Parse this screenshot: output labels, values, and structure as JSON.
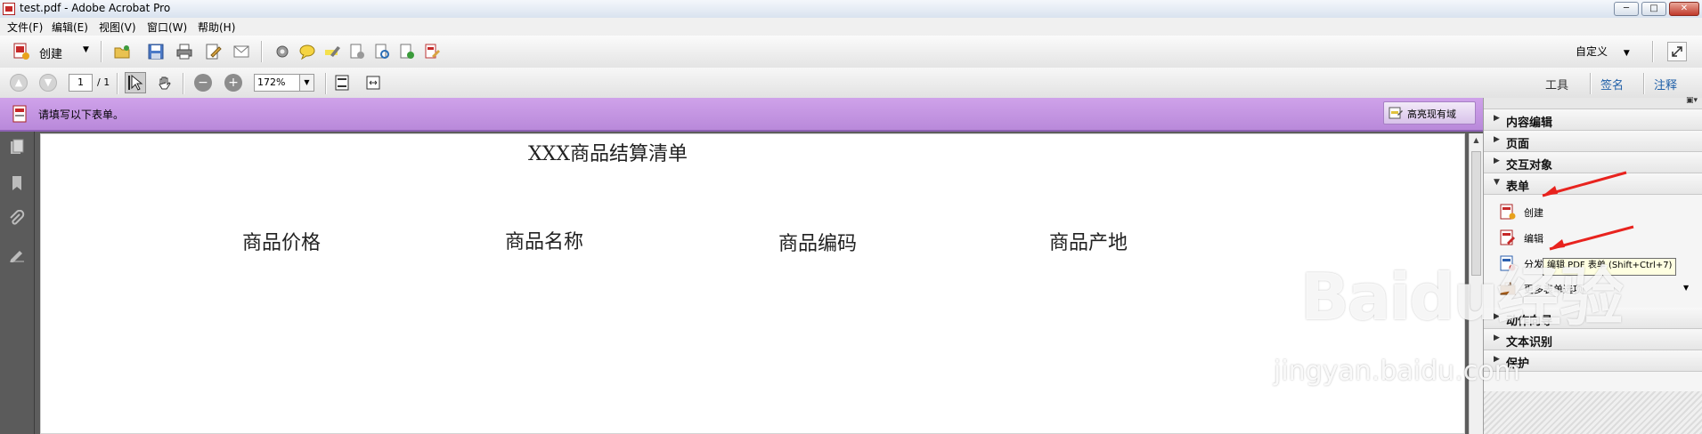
{
  "window": {
    "title": "test.pdf - Adobe Acrobat Pro",
    "min": "─",
    "max": "□",
    "close": "✕"
  },
  "menu": [
    {
      "label": "文件(F)"
    },
    {
      "label": "编辑(E)"
    },
    {
      "label": "视图(V)"
    },
    {
      "label": "窗口(W)"
    },
    {
      "label": "帮助(H)"
    }
  ],
  "toolbar": {
    "create_label": "创建",
    "customize_label": "自定义"
  },
  "nav": {
    "page_current": "1",
    "page_total": "/ 1",
    "zoom": "172%"
  },
  "panels": {
    "tools": "工具",
    "sign": "签名",
    "comment": "注释"
  },
  "formbar": {
    "message": "请填写以下表单。",
    "highlight_label": "高亮现有域"
  },
  "document": {
    "title": "XXX商品结算清单",
    "columns": [
      "商品价格",
      "商品名称",
      "商品编码",
      "商品产地"
    ]
  },
  "right_panel": {
    "sections_top": [
      "内容编辑",
      "页面",
      "交互对象"
    ],
    "forms_section": "表单",
    "form_items": [
      "创建",
      "编辑",
      "分发",
      "更多表单选项"
    ],
    "tooltip": "编辑 PDF 表单 (Shift+Ctrl+7)",
    "sections_bottom": [
      "动作向导",
      "文本识别",
      "保护"
    ]
  },
  "watermark": {
    "main": "Baidu经验",
    "sub": "jingyan.baidu.com"
  },
  "colors": {
    "formbar": "#c596e4",
    "accent_blue": "#1f5fa8",
    "arrow_red": "#e8231e"
  }
}
